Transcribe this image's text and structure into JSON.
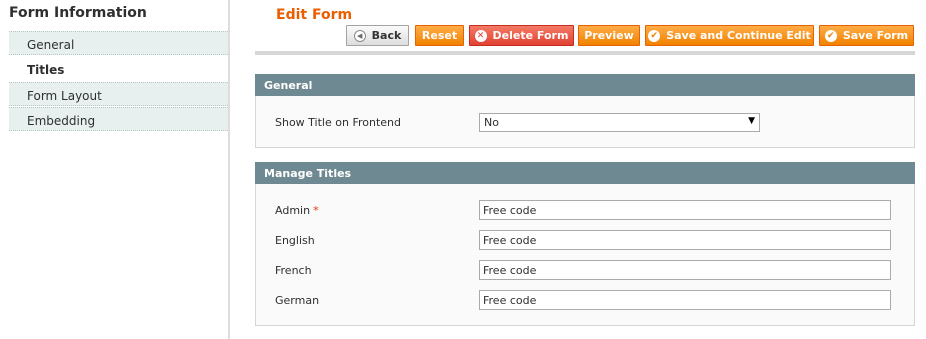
{
  "sidebar": {
    "title": "Form Information",
    "tabs": [
      {
        "label": "General",
        "active": false
      },
      {
        "label": "Titles",
        "active": true
      },
      {
        "label": "Form Layout",
        "active": false
      },
      {
        "label": "Embedding",
        "active": false
      }
    ]
  },
  "header": {
    "title": "Edit Form",
    "buttons": {
      "back": "Back",
      "reset": "Reset",
      "delete": "Delete Form",
      "preview": "Preview",
      "save_continue": "Save and Continue Edit",
      "save": "Save Form"
    }
  },
  "general": {
    "heading": "General",
    "show_title_label": "Show Title on Frontend",
    "show_title_value": "No"
  },
  "titles": {
    "heading": "Manage Titles",
    "rows": [
      {
        "label": "Admin",
        "required": "*",
        "value": "Free code"
      },
      {
        "label": "English",
        "value": "Free code"
      },
      {
        "label": "French",
        "value": "Free code"
      },
      {
        "label": "German",
        "value": "Free code"
      }
    ]
  },
  "colors": {
    "accent": "#eb5e00",
    "button_orange": "#f18200",
    "delete_red": "#e14233",
    "section_header": "#6f8992"
  },
  "icons": [
    "back-arrow-icon",
    "delete-icon",
    "checkmark-icon",
    "dropdown-arrow-icon"
  ]
}
